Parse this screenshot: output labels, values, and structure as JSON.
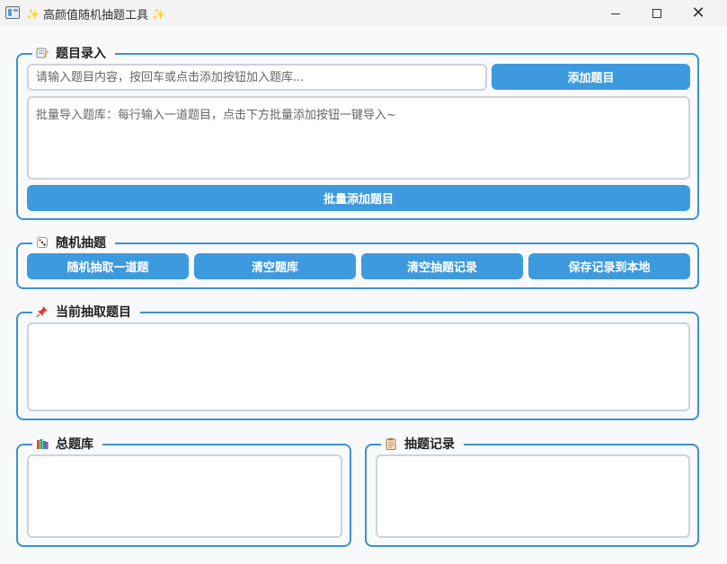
{
  "window": {
    "title": "高颜值随机抽题工具",
    "title_prefix_icon": "sparkle-icon",
    "title_suffix_icon": "sparkle-icon",
    "controls": [
      "minimize",
      "maximize",
      "close"
    ]
  },
  "entry": {
    "legend": "题目录入",
    "legend_icon": "memo-icon",
    "input_placeholder": "请输入题目内容，按回车或点击添加按钮加入题库...",
    "input_value": "",
    "add_label": "添加题目",
    "batch_placeholder": "批量导入题库：每行输入一道题目，点击下方批量添加按钮一键导入~",
    "batch_value": "",
    "batch_add_label": "批量添加题目"
  },
  "draw": {
    "legend": "随机抽题",
    "legend_icon": "dice-icon",
    "buttons": {
      "draw_one": "随机抽取一道题",
      "clear_bank": "清空题库",
      "clear_records": "清空抽题记录",
      "save_local": "保存记录到本地"
    }
  },
  "current": {
    "legend": "当前抽取题目",
    "legend_icon": "pushpin-icon",
    "content": ""
  },
  "bank": {
    "legend": "总题库",
    "legend_icon": "books-icon",
    "items": []
  },
  "records": {
    "legend": "抽题记录",
    "legend_icon": "clipboard-icon",
    "items": []
  },
  "colors": {
    "accent": "#3e9ade",
    "group_border": "#3d92cf",
    "field_border": "#cfd3d8",
    "background": "#f7f9fb"
  }
}
